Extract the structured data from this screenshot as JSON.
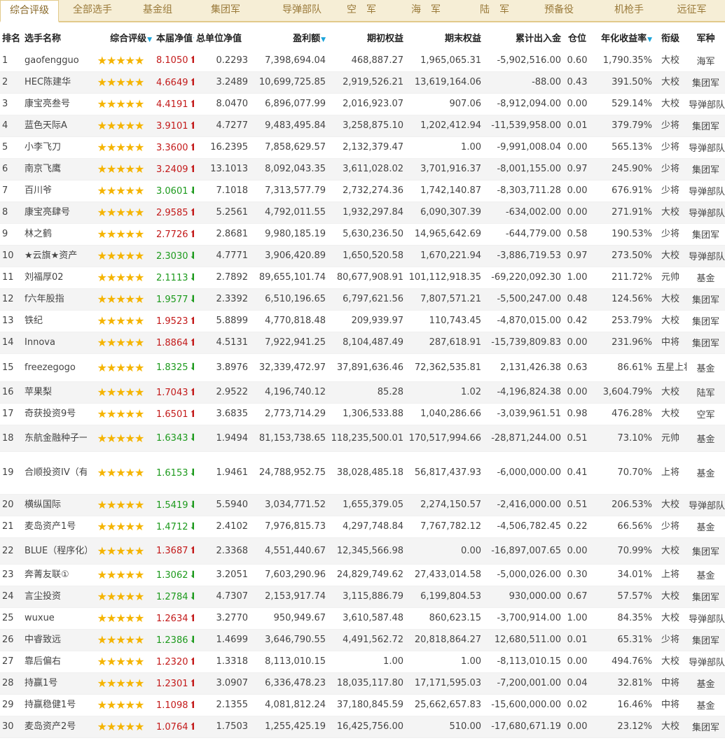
{
  "tabs": [
    {
      "label": "综合评级",
      "active": true
    },
    {
      "label": "全部选手"
    },
    {
      "label": "基金组"
    },
    {
      "label": "集团军"
    },
    {
      "label": "导弹部队"
    },
    {
      "label": "空　军"
    },
    {
      "label": "海　军"
    },
    {
      "label": "陆　军"
    },
    {
      "label": "预备役"
    },
    {
      "label": "机枪手"
    },
    {
      "label": "远征军"
    }
  ],
  "columns": [
    "排名",
    "选手名称",
    "综合评级",
    "本届净值",
    "总单位净值",
    "盈利额",
    "期初权益",
    "期末权益",
    "累计出入金",
    "仓位",
    "年化收益率",
    "衔级",
    "军种"
  ],
  "sort_icon": "sort-down-triangle-icon",
  "rating_stars": "★★★★★",
  "icons": {
    "up": "arrow-up-icon",
    "down": "arrow-down-icon",
    "star": "star-icon"
  },
  "colors": {
    "up": "#c31a1a",
    "down": "#1d9a1d",
    "star": "#f5b400",
    "sort": "#1aa3d9",
    "tab_bg": "#f6eed6"
  },
  "rows": [
    {
      "rank": "1",
      "name": "gaofengguo",
      "nav": "8.1050",
      "trend": "up",
      "unit_nav": "0.2293",
      "profit": "7,398,694.04",
      "begin": "468,887.27",
      "end": "1,965,065.31",
      "cum": "-5,902,516.00",
      "pos": "0.60",
      "annual": "1,790.35%",
      "rank_title": "大校",
      "branch": "海军"
    },
    {
      "rank": "2",
      "name": "HEC陈建华",
      "nav": "4.6649",
      "trend": "up",
      "unit_nav": "3.2489",
      "profit": "10,699,725.85",
      "begin": "2,919,526.21",
      "end": "13,619,164.06",
      "cum": "-88.00",
      "pos": "0.43",
      "annual": "391.50%",
      "rank_title": "大校",
      "branch": "集团军"
    },
    {
      "rank": "3",
      "name": "康宝亮叁号",
      "nav": "4.4191",
      "trend": "up",
      "unit_nav": "8.0470",
      "profit": "6,896,077.99",
      "begin": "2,016,923.07",
      "end": "907.06",
      "cum": "-8,912,094.00",
      "pos": "0.00",
      "annual": "529.14%",
      "rank_title": "大校",
      "branch": "导弹部队"
    },
    {
      "rank": "4",
      "name": "蓝色天际A",
      "nav": "3.9101",
      "trend": "up",
      "unit_nav": "4.7277",
      "profit": "9,483,495.84",
      "begin": "3,258,875.10",
      "end": "1,202,412.94",
      "cum": "-11,539,958.00",
      "pos": "0.01",
      "annual": "379.79%",
      "rank_title": "少将",
      "branch": "集团军"
    },
    {
      "rank": "5",
      "name": "小李飞刀",
      "nav": "3.3600",
      "trend": "up",
      "unit_nav": "16.2395",
      "profit": "7,858,629.57",
      "begin": "2,132,379.47",
      "end": "1.00",
      "cum": "-9,991,008.04",
      "pos": "0.00",
      "annual": "565.13%",
      "rank_title": "少将",
      "branch": "导弹部队"
    },
    {
      "rank": "6",
      "name": "南京飞鹰",
      "nav": "3.2409",
      "trend": "up",
      "unit_nav": "13.1013",
      "profit": "8,092,043.35",
      "begin": "3,611,028.02",
      "end": "3,701,916.37",
      "cum": "-8,001,155.00",
      "pos": "0.97",
      "annual": "245.90%",
      "rank_title": "少将",
      "branch": "集团军"
    },
    {
      "rank": "7",
      "name": "百川爷",
      "nav": "3.0601",
      "trend": "down",
      "unit_nav": "7.1018",
      "profit": "7,313,577.79",
      "begin": "2,732,274.36",
      "end": "1,742,140.87",
      "cum": "-8,303,711.28",
      "pos": "0.00",
      "annual": "676.91%",
      "rank_title": "少将",
      "branch": "导弹部队"
    },
    {
      "rank": "8",
      "name": "康宝亮肆号",
      "nav": "2.9585",
      "trend": "up",
      "unit_nav": "5.2561",
      "profit": "4,792,011.55",
      "begin": "1,932,297.84",
      "end": "6,090,307.39",
      "cum": "-634,002.00",
      "pos": "0.00",
      "annual": "271.91%",
      "rank_title": "大校",
      "branch": "导弹部队"
    },
    {
      "rank": "9",
      "name": "林之鹤",
      "nav": "2.7726",
      "trend": "up",
      "unit_nav": "2.8681",
      "profit": "9,980,185.19",
      "begin": "5,630,236.50",
      "end": "14,965,642.69",
      "cum": "-644,779.00",
      "pos": "0.58",
      "annual": "190.53%",
      "rank_title": "少将",
      "branch": "集团军"
    },
    {
      "rank": "10",
      "name": "★云旗★资产",
      "nav": "2.3030",
      "trend": "down",
      "unit_nav": "4.7771",
      "profit": "3,906,420.89",
      "begin": "1,650,520.58",
      "end": "1,670,221.94",
      "cum": "-3,886,719.53",
      "pos": "0.97",
      "annual": "273.50%",
      "rank_title": "大校",
      "branch": "导弹部队"
    },
    {
      "rank": "11",
      "name": "刘福厚02",
      "nav": "2.1113",
      "trend": "down",
      "unit_nav": "2.7892",
      "profit": "89,655,101.74",
      "begin": "80,677,908.91",
      "end": "101,112,918.35",
      "cum": "-69,220,092.30",
      "pos": "1.00",
      "annual": "211.72%",
      "rank_title": "元帅",
      "branch": "基金"
    },
    {
      "rank": "12",
      "name": "f六年股指",
      "nav": "1.9577",
      "trend": "down",
      "unit_nav": "2.3392",
      "profit": "6,510,196.65",
      "begin": "6,797,621.56",
      "end": "7,807,571.21",
      "cum": "-5,500,247.00",
      "pos": "0.48",
      "annual": "124.56%",
      "rank_title": "大校",
      "branch": "集团军"
    },
    {
      "rank": "13",
      "name": "铁纪",
      "nav": "1.9523",
      "trend": "up",
      "unit_nav": "5.8899",
      "profit": "4,770,818.48",
      "begin": "209,939.97",
      "end": "110,743.45",
      "cum": "-4,870,015.00",
      "pos": "0.42",
      "annual": "253.79%",
      "rank_title": "大校",
      "branch": "集团军"
    },
    {
      "rank": "14",
      "name": "Innova",
      "nav": "1.8864",
      "trend": "up",
      "unit_nav": "4.5131",
      "profit": "7,922,941.25",
      "begin": "8,104,487.49",
      "end": "287,618.91",
      "cum": "-15,739,809.83",
      "pos": "0.00",
      "annual": "231.96%",
      "rank_title": "中将",
      "branch": "集团军"
    },
    {
      "rank": "15",
      "name": "freezegogo",
      "nav": "1.8325",
      "trend": "down",
      "unit_nav": "3.8976",
      "profit": "32,339,472.97",
      "begin": "37,891,636.46",
      "end": "72,362,535.81",
      "cum": "2,131,426.38",
      "pos": "0.63",
      "annual": "86.61%",
      "rank_title": "五星上将",
      "branch": "基金"
    },
    {
      "rank": "16",
      "name": "苹果梨",
      "nav": "1.7043",
      "trend": "up",
      "unit_nav": "2.9522",
      "profit": "4,196,740.12",
      "begin": "85.28",
      "end": "1.02",
      "cum": "-4,196,824.38",
      "pos": "0.00",
      "annual": "3,604.79%",
      "rank_title": "大校",
      "branch": "陆军"
    },
    {
      "rank": "17",
      "name": "奇获投资9号",
      "nav": "1.6501",
      "trend": "up",
      "unit_nav": "3.6835",
      "profit": "2,773,714.29",
      "begin": "1,306,533.88",
      "end": "1,040,286.66",
      "cum": "-3,039,961.51",
      "pos": "0.98",
      "annual": "476.28%",
      "rank_title": "大校",
      "branch": "空军"
    },
    {
      "rank": "18",
      "name": "东航金融种子一号",
      "nav": "1.6343",
      "trend": "down",
      "unit_nav": "1.9494",
      "profit": "81,153,738.65",
      "begin": "118,235,500.01",
      "end": "170,517,994.66",
      "cum": "-28,871,244.00",
      "pos": "0.51",
      "annual": "73.10%",
      "rank_title": "元帅",
      "branch": "基金"
    },
    {
      "rank": "19",
      "name": "合顺投资IV（有限合伙）",
      "nav": "1.6153",
      "trend": "down",
      "unit_nav": "1.9461",
      "profit": "24,788,952.75",
      "begin": "38,028,485.18",
      "end": "56,817,437.93",
      "cum": "-6,000,000.00",
      "pos": "0.41",
      "annual": "70.70%",
      "rank_title": "上将",
      "branch": "基金"
    },
    {
      "rank": "20",
      "name": "横纵国际",
      "nav": "1.5419",
      "trend": "down",
      "unit_nav": "5.5940",
      "profit": "3,034,771.52",
      "begin": "1,655,379.05",
      "end": "2,274,150.57",
      "cum": "-2,416,000.00",
      "pos": "0.51",
      "annual": "206.53%",
      "rank_title": "大校",
      "branch": "导弹部队"
    },
    {
      "rank": "21",
      "name": "麦岛资产1号",
      "nav": "1.4712",
      "trend": "down",
      "unit_nav": "2.4102",
      "profit": "7,976,815.73",
      "begin": "4,297,748.84",
      "end": "7,767,782.12",
      "cum": "-4,506,782.45",
      "pos": "0.22",
      "annual": "66.56%",
      "rank_title": "少将",
      "branch": "基金"
    },
    {
      "rank": "22",
      "name": "BLUE（程序化）",
      "nav": "1.3687",
      "trend": "up",
      "unit_nav": "2.3368",
      "profit": "4,551,440.67",
      "begin": "12,345,566.98",
      "end": "0.00",
      "cum": "-16,897,007.65",
      "pos": "0.00",
      "annual": "70.99%",
      "rank_title": "大校",
      "branch": "集团军"
    },
    {
      "rank": "23",
      "name": "奔菁友联①",
      "nav": "1.3062",
      "trend": "down",
      "unit_nav": "3.2051",
      "profit": "7,603,290.96",
      "begin": "24,829,749.62",
      "end": "27,433,014.58",
      "cum": "-5,000,026.00",
      "pos": "0.30",
      "annual": "34.01%",
      "rank_title": "上将",
      "branch": "基金"
    },
    {
      "rank": "24",
      "name": "言尘投资",
      "nav": "1.2784",
      "trend": "down",
      "unit_nav": "4.7307",
      "profit": "2,153,917.74",
      "begin": "3,115,886.79",
      "end": "6,199,804.53",
      "cum": "930,000.00",
      "pos": "0.67",
      "annual": "57.57%",
      "rank_title": "大校",
      "branch": "集团军"
    },
    {
      "rank": "25",
      "name": "wuxue",
      "nav": "1.2634",
      "trend": "up",
      "unit_nav": "3.2770",
      "profit": "950,949.67",
      "begin": "3,610,587.48",
      "end": "860,623.15",
      "cum": "-3,700,914.00",
      "pos": "1.00",
      "annual": "84.35%",
      "rank_title": "大校",
      "branch": "导弹部队"
    },
    {
      "rank": "26",
      "name": "中睿致远",
      "nav": "1.2386",
      "trend": "down",
      "unit_nav": "1.4699",
      "profit": "3,646,790.55",
      "begin": "4,491,562.72",
      "end": "20,818,864.27",
      "cum": "12,680,511.00",
      "pos": "0.01",
      "annual": "65.31%",
      "rank_title": "少将",
      "branch": "集团军"
    },
    {
      "rank": "27",
      "name": "靠后偏右",
      "nav": "1.2320",
      "trend": "up",
      "unit_nav": "1.3318",
      "profit": "8,113,010.15",
      "begin": "1.00",
      "end": "1.00",
      "cum": "-8,113,010.15",
      "pos": "0.00",
      "annual": "494.76%",
      "rank_title": "大校",
      "branch": "导弹部队"
    },
    {
      "rank": "28",
      "name": "持赢1号",
      "nav": "1.2301",
      "trend": "up",
      "unit_nav": "3.0907",
      "profit": "6,336,478.23",
      "begin": "18,035,117.80",
      "end": "17,171,595.03",
      "cum": "-7,200,001.00",
      "pos": "0.04",
      "annual": "32.81%",
      "rank_title": "中将",
      "branch": "基金"
    },
    {
      "rank": "29",
      "name": "持赢稳健1号",
      "nav": "1.1098",
      "trend": "up",
      "unit_nav": "2.1355",
      "profit": "4,081,812.24",
      "begin": "37,180,845.59",
      "end": "25,662,657.83",
      "cum": "-15,600,000.00",
      "pos": "0.02",
      "annual": "16.46%",
      "rank_title": "中将",
      "branch": "基金"
    },
    {
      "rank": "30",
      "name": "麦岛资产2号",
      "nav": "1.0764",
      "trend": "up",
      "unit_nav": "1.7503",
      "profit": "1,255,425.19",
      "begin": "16,425,756.00",
      "end": "510.00",
      "cum": "-17,680,671.19",
      "pos": "0.00",
      "annual": "23.12%",
      "rank_title": "大校",
      "branch": "集团军"
    }
  ]
}
